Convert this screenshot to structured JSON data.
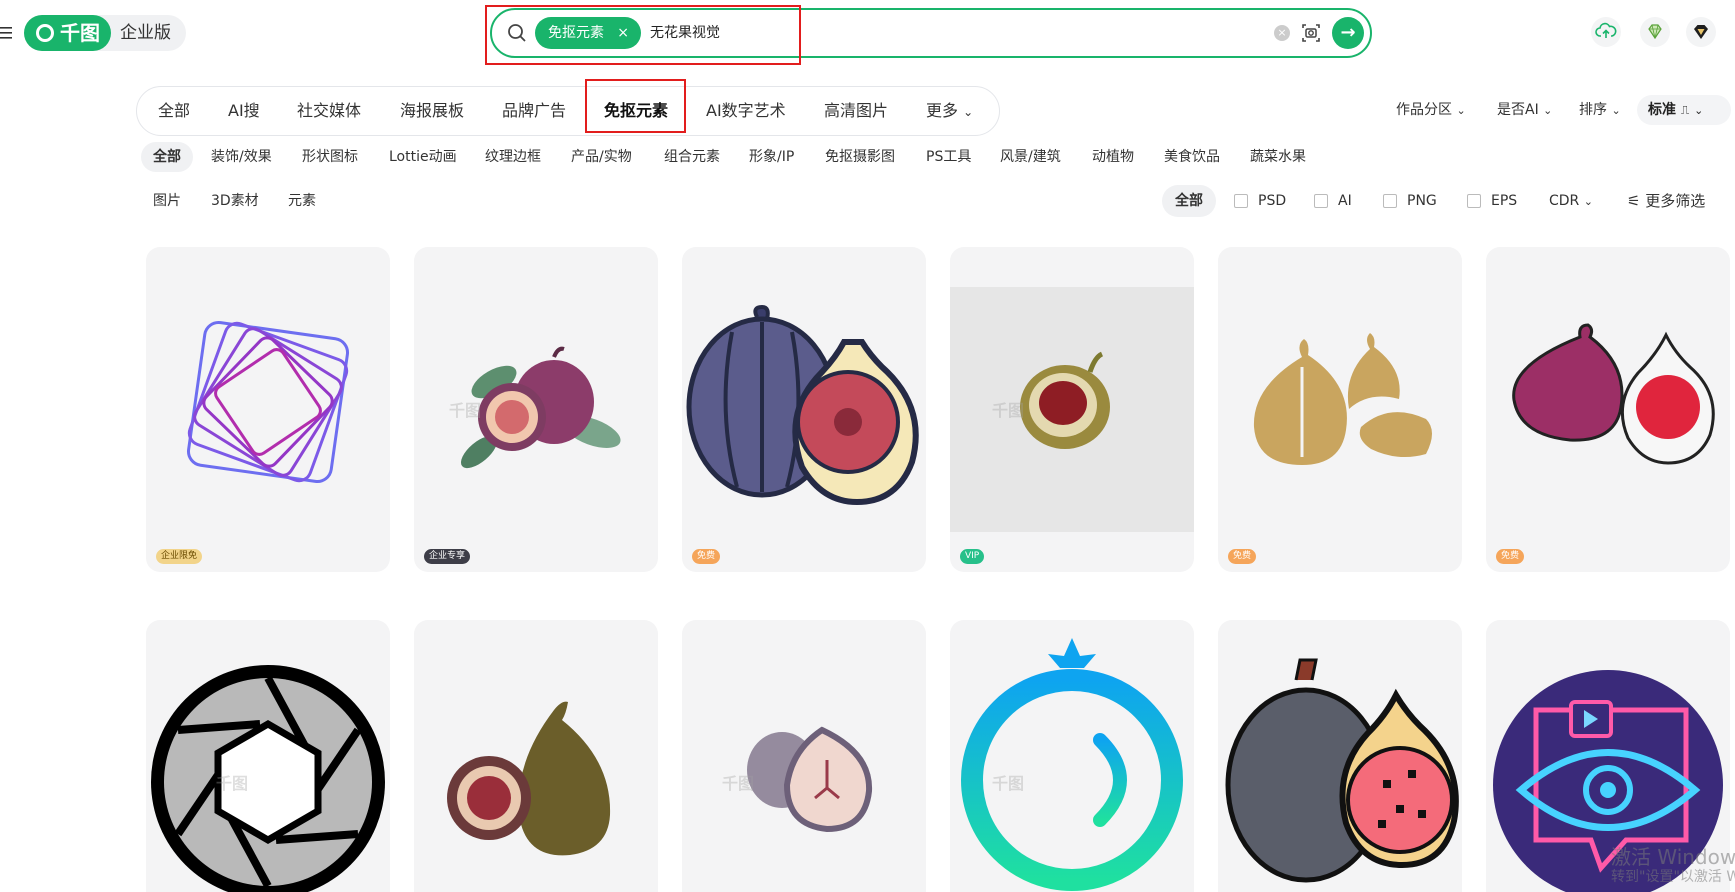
{
  "header": {
    "logo_text": "千图",
    "logo_edition": "企业版",
    "search": {
      "chip": "免抠元素",
      "chip_close": "×",
      "query": "无花果视觉"
    }
  },
  "tabs": [
    "全部",
    "AI搜",
    "社交媒体",
    "海报展板",
    "品牌广告",
    "免抠元素",
    "AI数字艺术",
    "高清图片",
    "更多"
  ],
  "active_tab": "免抠元素",
  "filters": {
    "zone": "作品分区",
    "is_ai": "是否AI",
    "sort": "排序",
    "standard": "标准"
  },
  "subcategories": [
    "全部",
    "装饰/效果",
    "形状图标",
    "Lottie动画",
    "纹理边框",
    "产品/实物",
    "组合元素",
    "形象/IP",
    "免抠摄影图",
    "PS工具",
    "风景/建筑",
    "动植物",
    "美食饮品",
    "蔬菜水果"
  ],
  "types": [
    "图片",
    "3D素材",
    "元素"
  ],
  "formats": {
    "all": "全部",
    "options": [
      "PSD",
      "AI",
      "PNG",
      "EPS"
    ],
    "cdr": "CDR",
    "more": "更多筛选"
  },
  "badges": {
    "enterprise_free": "企业限免",
    "enterprise_exclusive": "企业专享",
    "free": "免费",
    "vip": "VIP"
  },
  "watermark": "千图",
  "overlay": {
    "line1": "激活 Window",
    "line2": "转到\"设置\"以激活 W"
  },
  "colors": {
    "brand_green": "#19b46b",
    "highlight_red": "#e21d1d"
  }
}
